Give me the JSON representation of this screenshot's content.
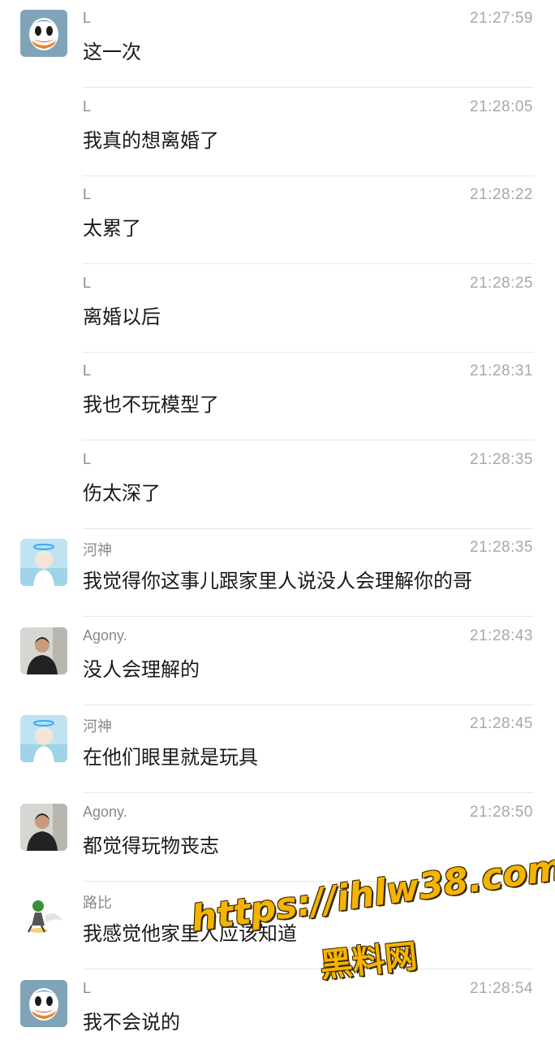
{
  "messages": [
    {
      "sender": "L",
      "time": "21:27:59",
      "text": "这一次",
      "avatar": "duck-avatar"
    },
    {
      "sender": "L",
      "time": "21:28:05",
      "text": "我真的想离婚了",
      "avatar": null
    },
    {
      "sender": "L",
      "time": "21:28:22",
      "text": "太累了",
      "avatar": null
    },
    {
      "sender": "L",
      "time": "21:28:25",
      "text": "离婚以后",
      "avatar": null
    },
    {
      "sender": "L",
      "time": "21:28:31",
      "text": "我也不玩模型了",
      "avatar": null
    },
    {
      "sender": "L",
      "time": "21:28:35",
      "text": "伤太深了",
      "avatar": null
    },
    {
      "sender": "河神",
      "time": "21:28:35",
      "text": "我觉得你这事儿跟家里人说没人会理解你的哥",
      "avatar": "anime-avatar"
    },
    {
      "sender": "Agony.",
      "time": "21:28:43",
      "text": "没人会理解的",
      "avatar": "photo-avatar"
    },
    {
      "sender": "河神",
      "time": "21:28:45",
      "text": "在他们眼里就是玩具",
      "avatar": "anime-avatar"
    },
    {
      "sender": "Agony.",
      "time": "21:28:50",
      "text": "都觉得玩物丧志",
      "avatar": "photo-avatar"
    },
    {
      "sender": "路比",
      "time": "",
      "text": "我感觉他家里人应该知道",
      "avatar": "cartoon-avatar"
    },
    {
      "sender": "L",
      "time": "21:28:54",
      "text": "我不会说的",
      "avatar": "duck-avatar"
    }
  ],
  "watermark": {
    "url": "https://ihlw38.com",
    "label": "黑料网"
  },
  "colors": {
    "text": "#1a1a1a",
    "sender": "#8a8a8a",
    "time": "#a8a8a8",
    "divider": "#e8e8e8",
    "watermark": "#f5b400"
  }
}
